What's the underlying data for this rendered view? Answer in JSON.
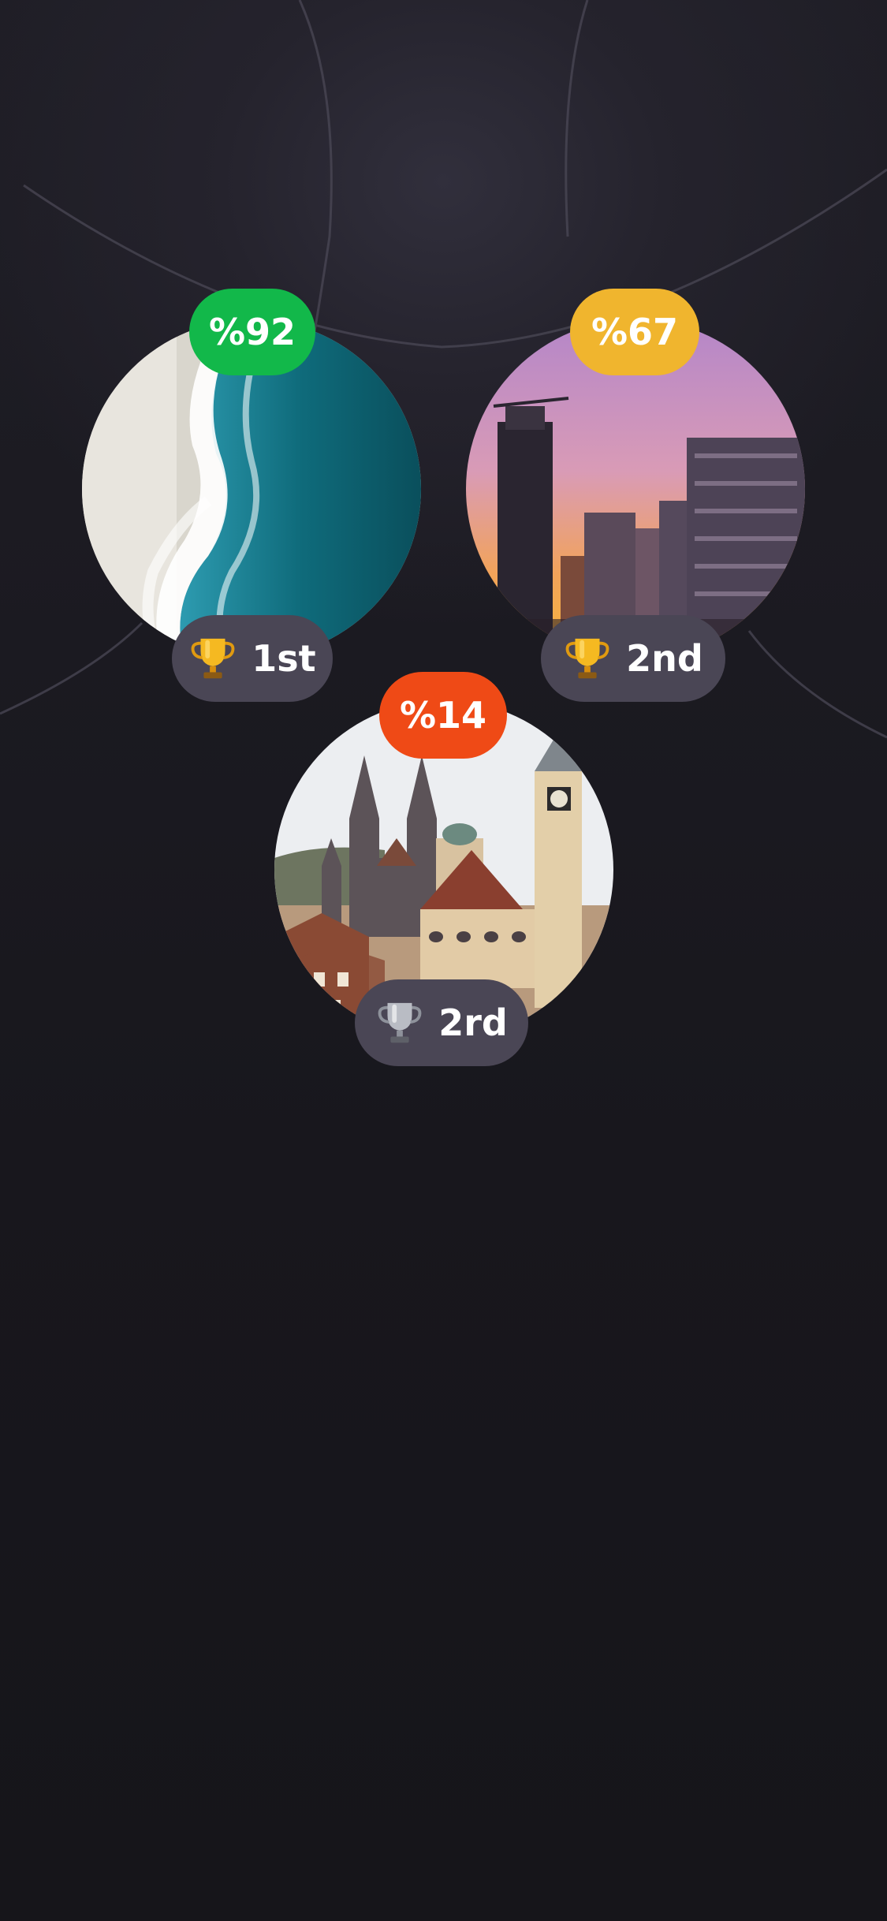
{
  "cards": [
    {
      "percent": "%92",
      "badge_color": "#12b84a",
      "rank_label": "1st",
      "trophy": "gold-trophy-icon",
      "photo": "beach-ocean-aerial"
    },
    {
      "percent": "%67",
      "badge_color": "#f0b52e",
      "rank_label": "2nd",
      "trophy": "gold-trophy-icon",
      "photo": "city-skyscrapers-sunset"
    },
    {
      "percent": "%14",
      "badge_color": "#ef4a16",
      "rank_label": "2rd",
      "trophy": "silver-trophy-icon",
      "photo": "prague-old-town-spires"
    }
  ]
}
